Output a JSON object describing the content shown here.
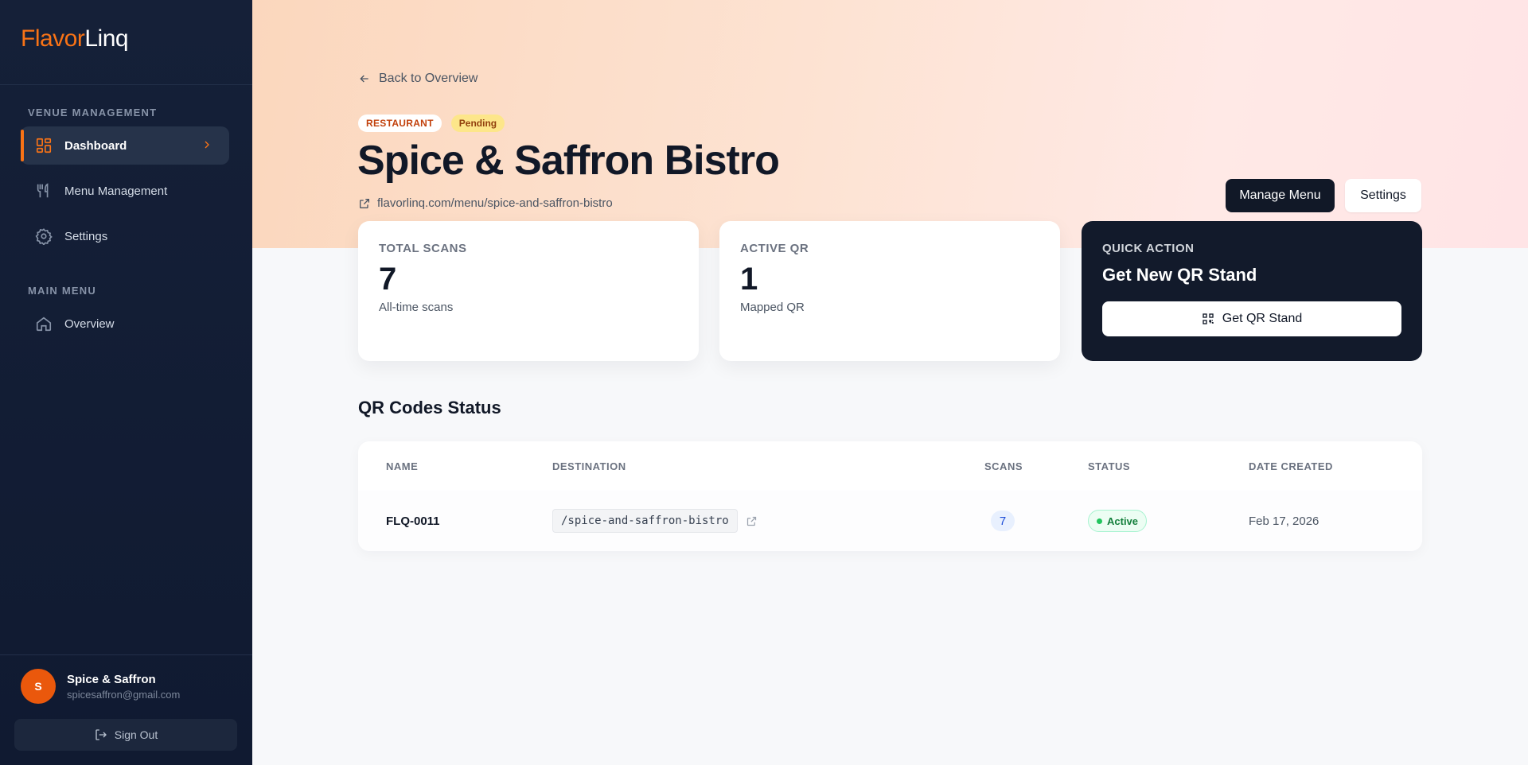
{
  "brand": {
    "part1": "Flavor",
    "part2": "Linq"
  },
  "sidebar": {
    "section_venue": "VENUE MANAGEMENT",
    "section_main": "MAIN MENU",
    "items": [
      {
        "label": "Dashboard",
        "icon": "dashboard-icon",
        "active": true
      },
      {
        "label": "Menu Management",
        "icon": "utensils-icon"
      },
      {
        "label": "Settings",
        "icon": "gear-icon"
      },
      {
        "label": "Overview",
        "icon": "home-icon"
      }
    ],
    "user": {
      "initial": "S",
      "name": "Spice & Saffron",
      "email": "spicesaffron@gmail.com"
    },
    "signout_label": "Sign Out"
  },
  "header": {
    "back_label": "Back to Overview",
    "badges": {
      "type": "RESTAURANT",
      "status": "Pending"
    },
    "title": "Spice & Saffron Bistro",
    "url": "flavorlinq.com/menu/spice-and-saffron-bistro",
    "manage_menu_label": "Manage Menu",
    "settings_label": "Settings"
  },
  "stats": [
    {
      "label": "TOTAL SCANS",
      "value": "7",
      "sub": "All-time scans"
    },
    {
      "label": "ACTIVE QR",
      "value": "1",
      "sub": "Mapped QR"
    }
  ],
  "quick_action": {
    "label": "QUICK ACTION",
    "title": "Get New QR Stand",
    "button_label": "Get QR Stand"
  },
  "qr_section": {
    "title": "QR Codes Status",
    "columns": [
      "NAME",
      "DESTINATION",
      "SCANS",
      "STATUS",
      "DATE CREATED"
    ],
    "rows": [
      {
        "name": "FLQ-0011",
        "destination": "/spice-and-saffron-bistro",
        "scans": "7",
        "status": "Active",
        "date": "Feb 17, 2026"
      }
    ]
  },
  "colors": {
    "accent": "#f97316",
    "sidebar_bg": "#152038",
    "dark": "#111827"
  }
}
